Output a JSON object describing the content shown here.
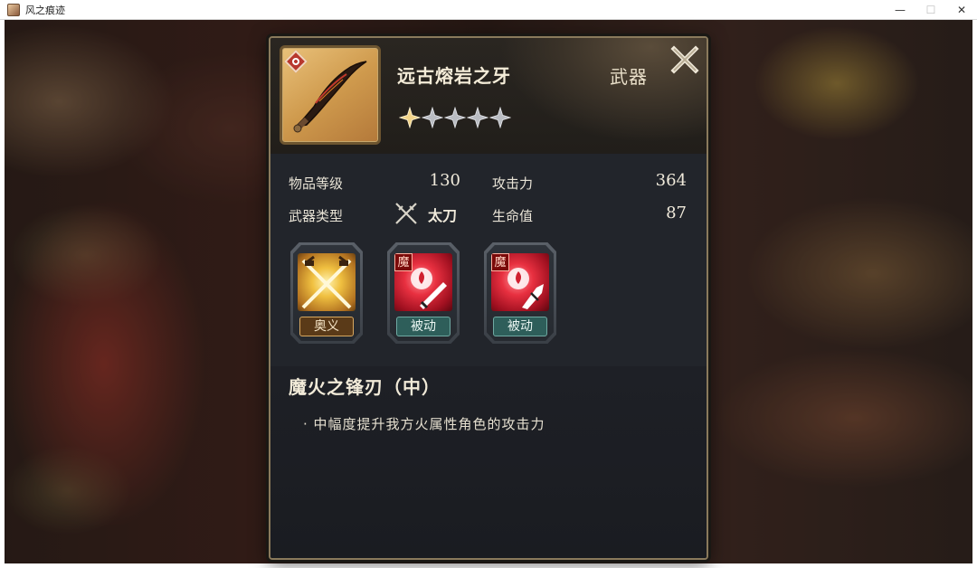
{
  "window": {
    "title": "风之痕迹",
    "minimize": "—",
    "maximize": "☐",
    "close": "✕"
  },
  "item": {
    "name": "远古熔岩之牙",
    "category": "武器",
    "stars_filled": 1,
    "stars_total": 5
  },
  "stats": {
    "level_label": "物品等级",
    "level_value": "130",
    "weapon_type_label": "武器类型",
    "weapon_type_value": "太刀",
    "attack_label": "攻击力",
    "attack_value": "364",
    "hp_label": "生命值",
    "hp_value": "87"
  },
  "skills": [
    {
      "label": "奥义",
      "icon": "crossed-swords-icon"
    },
    {
      "label": "被动",
      "icon": "fire-sword-icon",
      "badge": "魔"
    },
    {
      "label": "被动",
      "icon": "fire-spear-icon",
      "badge": "魔"
    }
  ],
  "description": {
    "title": "魔火之锋刃（中）",
    "text": "· 中幅度提升我方火属性角色的攻击力"
  },
  "colors": {
    "gold": "#d8a860",
    "teal": "#2e5e5a",
    "red": "#c21b24"
  }
}
